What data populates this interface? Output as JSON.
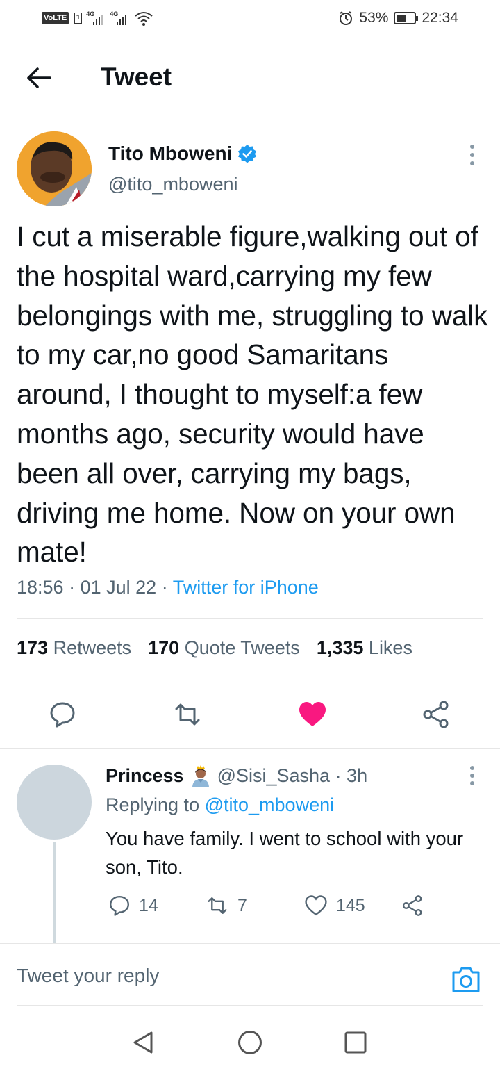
{
  "status_bar": {
    "volte": "VoLTE",
    "sim_number": "1",
    "network1": "4G",
    "network2": "4G",
    "battery": "53%",
    "battery_level": 0.53,
    "time": "22:34"
  },
  "header": {
    "title": "Tweet"
  },
  "tweet": {
    "author_name": "Tito Mboweni",
    "author_handle": "@tito_mboweni",
    "text": "I cut a miserable figure,walking out of the hospital ward,carrying my few belongings with me, struggling to walk to my car,no good Samaritans around, I thought to myself:a few months ago, security would have been all over, carrying my bags, driving me home. Now on your own mate!",
    "time": "18:56",
    "date": "01 Jul 22",
    "separator": "·",
    "source": "Twitter for iPhone",
    "stats": {
      "retweets_count": "173",
      "retweets_label": "Retweets",
      "quotes_count": "170",
      "quotes_label": "Quote Tweets",
      "likes_count": "1,335",
      "likes_label": "Likes"
    },
    "liked": true
  },
  "reply": {
    "name": "Princess",
    "handle": "@Sisi_Sasha · 3h",
    "replying_prefix": "Replying to",
    "replying_to": "@tito_mboweni",
    "text": "You have family. I went to school with your son, Tito.",
    "reply_count": "14",
    "retweet_count": "7",
    "like_count": "145"
  },
  "compose": {
    "placeholder": "Tweet your reply"
  },
  "colors": {
    "accent": "#1d9bf0",
    "like": "#f91880",
    "muted": "#536471"
  }
}
